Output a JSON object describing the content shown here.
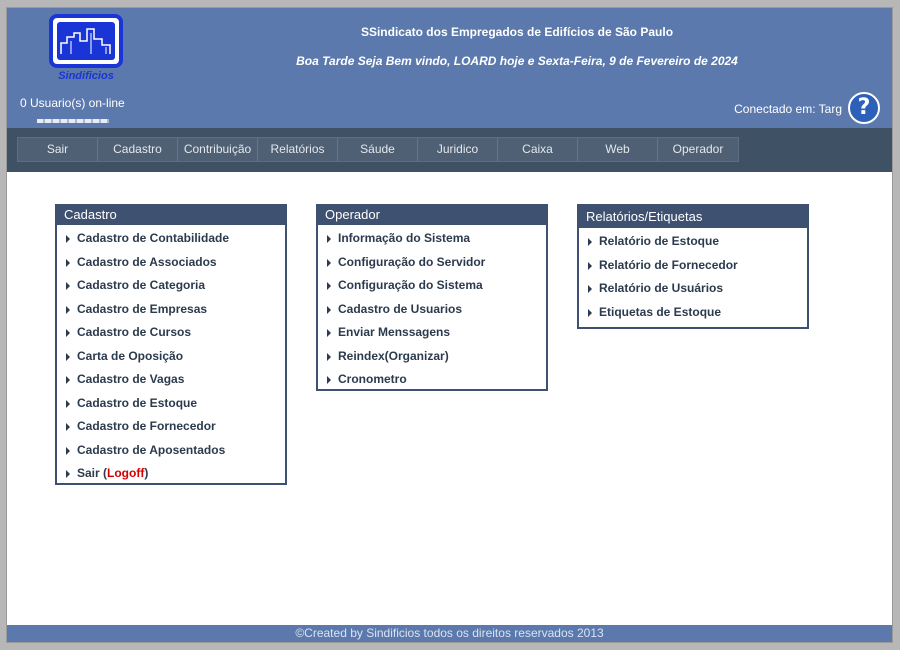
{
  "header": {
    "logo_text": "Sindificios",
    "site_name": "SSindicato dos Empregados de Edifícios de São Paulo",
    "greeting": "Boa Tarde Seja Bem vindo, LOARD hoje e Sexta-Feira, 9 de Fevereiro de 2024",
    "users_online": "0 Usuario(s) on-line",
    "connected_label": "Conectado em:",
    "connected_user": "Targ",
    "help_icon": "help-icon"
  },
  "nav": {
    "items": [
      {
        "label": "Sair"
      },
      {
        "label": "Cadastro"
      },
      {
        "label": "Contribuição"
      },
      {
        "label": "Relatórios"
      },
      {
        "label": "Sáude"
      },
      {
        "label": "Juridico"
      },
      {
        "label": "Caixa"
      },
      {
        "label": "Web"
      },
      {
        "label": "Operador"
      }
    ]
  },
  "panels": {
    "cadastro": {
      "title": "Cadastro",
      "items": [
        {
          "label": "Cadastro de Contabilidade"
        },
        {
          "label": "Cadastro de Associados"
        },
        {
          "label": "Cadastro de Categoria"
        },
        {
          "label": "Cadastro de Empresas"
        },
        {
          "label": "Cadastro de Cursos"
        },
        {
          "label": "Carta de Oposição"
        },
        {
          "label": "Cadastro de Vagas"
        },
        {
          "label": "Cadastro de Estoque"
        },
        {
          "label": "Cadastro de Fornecedor"
        },
        {
          "label": "Cadastro de Aposentados"
        }
      ],
      "logout": {
        "prefix": "Sair (",
        "link": "Logoff",
        "suffix": ")"
      }
    },
    "operador": {
      "title": "Operador",
      "items": [
        {
          "label": "Informação do Sistema"
        },
        {
          "label": "Configuração do Servidor"
        },
        {
          "label": "Configuração do Sistema"
        },
        {
          "label": "Cadastro de Usuarios"
        },
        {
          "label": "Enviar Menssagens"
        },
        {
          "label": "Reindex(Organizar)"
        },
        {
          "label": "Cronometro"
        }
      ]
    },
    "relatorios": {
      "title": "Relatórios/Etiquetas",
      "items": [
        {
          "label": "Relatório de Estoque"
        },
        {
          "label": "Relatório de Fornecedor"
        },
        {
          "label": "Relatório de Usuários"
        },
        {
          "label": "Etiquetas de Estoque"
        }
      ]
    }
  },
  "footer": {
    "text": "©Created by Sindificios todos os direitos reservados 2013"
  },
  "colors": {
    "header_bg": "#5b79ac",
    "nav_bg": "#3f5165",
    "panel_title_bg": "#3e5170",
    "logoff": "#d40000"
  }
}
